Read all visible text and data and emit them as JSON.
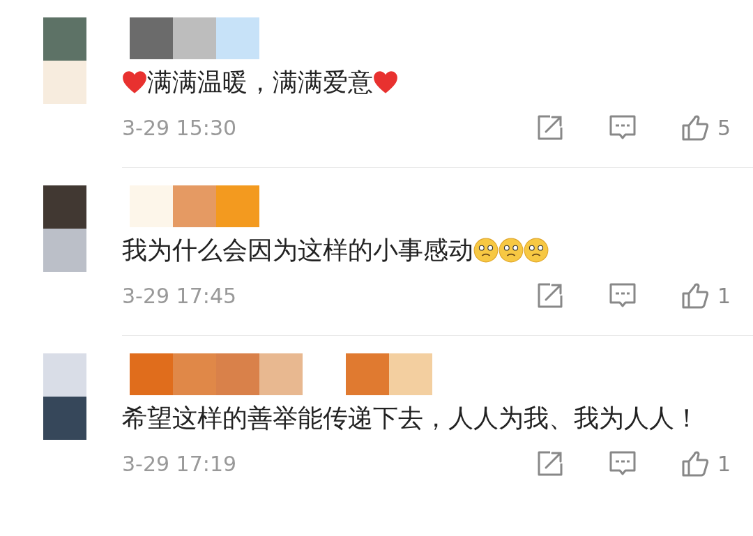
{
  "comments": [
    {
      "avatar": {
        "kind": "picture"
      },
      "name": {
        "kind": "picture"
      },
      "content": [
        {
          "kind": "heart"
        },
        {
          "kind": "text",
          "text": "满满温暖，满满爱意"
        },
        {
          "kind": "heart"
        }
      ],
      "time": "3-29 15:30",
      "likes": "5"
    },
    {
      "avatar": {
        "kind": "picture"
      },
      "name": {
        "kind": "picture"
      },
      "content": [
        {
          "kind": "text",
          "text": "我为什么会因为这样的小事感动"
        },
        {
          "kind": "sad-face"
        },
        {
          "kind": "sad-face"
        },
        {
          "kind": "sad-face"
        }
      ],
      "time": "3-29 17:45",
      "likes": "1"
    },
    {
      "avatar": {
        "kind": "picture"
      },
      "name": {
        "kind": "picture"
      },
      "content": [
        {
          "kind": "text",
          "text": "希望这样的善举能传递下去，人人为我、我为人人！"
        }
      ],
      "time": "3-29 17:19",
      "likes": "1"
    }
  ]
}
